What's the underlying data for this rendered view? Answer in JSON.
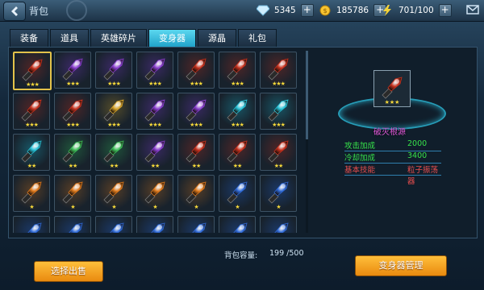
{
  "topbar": {
    "title": "背包",
    "diamonds": "5345",
    "gold": "185786",
    "energy": "701/100",
    "icons": [
      "back-arrow-icon",
      "diamond-icon",
      "gold-coin-icon",
      "energy-bolt-icon",
      "mail-icon"
    ]
  },
  "tabs": [
    {
      "label": "装备",
      "active": false
    },
    {
      "label": "道具",
      "active": false
    },
    {
      "label": "英雄碎片",
      "active": false
    },
    {
      "label": "变身器",
      "active": true
    },
    {
      "label": "源晶",
      "active": false
    },
    {
      "label": "礼包",
      "active": false
    }
  ],
  "inventory": {
    "items": [
      {
        "variant": "red",
        "stars": 3,
        "selected": true
      },
      {
        "variant": "violet",
        "stars": 3
      },
      {
        "variant": "violet",
        "stars": 3
      },
      {
        "variant": "violet",
        "stars": 3
      },
      {
        "variant": "red",
        "stars": 3
      },
      {
        "variant": "red",
        "stars": 3
      },
      {
        "variant": "red",
        "stars": 3
      },
      {
        "variant": "red",
        "stars": 3
      },
      {
        "variant": "red",
        "stars": 3
      },
      {
        "variant": "gold",
        "stars": 3
      },
      {
        "variant": "violet",
        "stars": 3
      },
      {
        "variant": "violet",
        "stars": 3
      },
      {
        "variant": "cyan",
        "stars": 3
      },
      {
        "variant": "cyan",
        "stars": 3
      },
      {
        "variant": "cyan",
        "stars": 2
      },
      {
        "variant": "green",
        "stars": 2
      },
      {
        "variant": "green",
        "stars": 2
      },
      {
        "variant": "violet",
        "stars": 2
      },
      {
        "variant": "red",
        "stars": 2
      },
      {
        "variant": "red",
        "stars": 2
      },
      {
        "variant": "red",
        "stars": 2
      },
      {
        "variant": "orange",
        "stars": 1
      },
      {
        "variant": "orange",
        "stars": 1
      },
      {
        "variant": "orange",
        "stars": 1
      },
      {
        "variant": "orange",
        "stars": 1
      },
      {
        "variant": "orange",
        "stars": 1
      },
      {
        "variant": "blue",
        "stars": 1
      },
      {
        "variant": "blue",
        "stars": 1
      },
      {
        "variant": "blue",
        "stars": 1
      },
      {
        "variant": "blue",
        "stars": 1
      },
      {
        "variant": "blue",
        "stars": 1
      },
      {
        "variant": "blue",
        "stars": 1
      },
      {
        "variant": "blue",
        "stars": 1
      },
      {
        "variant": "blue",
        "stars": 1
      },
      {
        "variant": "blue",
        "stars": 1
      }
    ]
  },
  "detail": {
    "name": "破灭根源",
    "stars": 3,
    "stats": [
      {
        "key": "攻击加成",
        "value": "2000",
        "color": "#37e24a"
      },
      {
        "key": "冷却加成",
        "value": "3400",
        "color": "#37e24a"
      },
      {
        "key": "基本技能",
        "value": "粒子振荡器",
        "color": "#e84e4e"
      }
    ]
  },
  "footer": {
    "capacity_label": "背包容量:",
    "capacity_value": "199 /500",
    "sell_button": "选择出售",
    "manage_button": "变身器管理"
  },
  "colors": {
    "red": "#c8321e",
    "violet": "#8a3fd0",
    "gold": "#d8a52a",
    "cyan": "#27c3d8",
    "green": "#3fbf5a",
    "orange": "#e07a1c",
    "blue": "#2f6ad8",
    "star": "#f5d83a"
  }
}
